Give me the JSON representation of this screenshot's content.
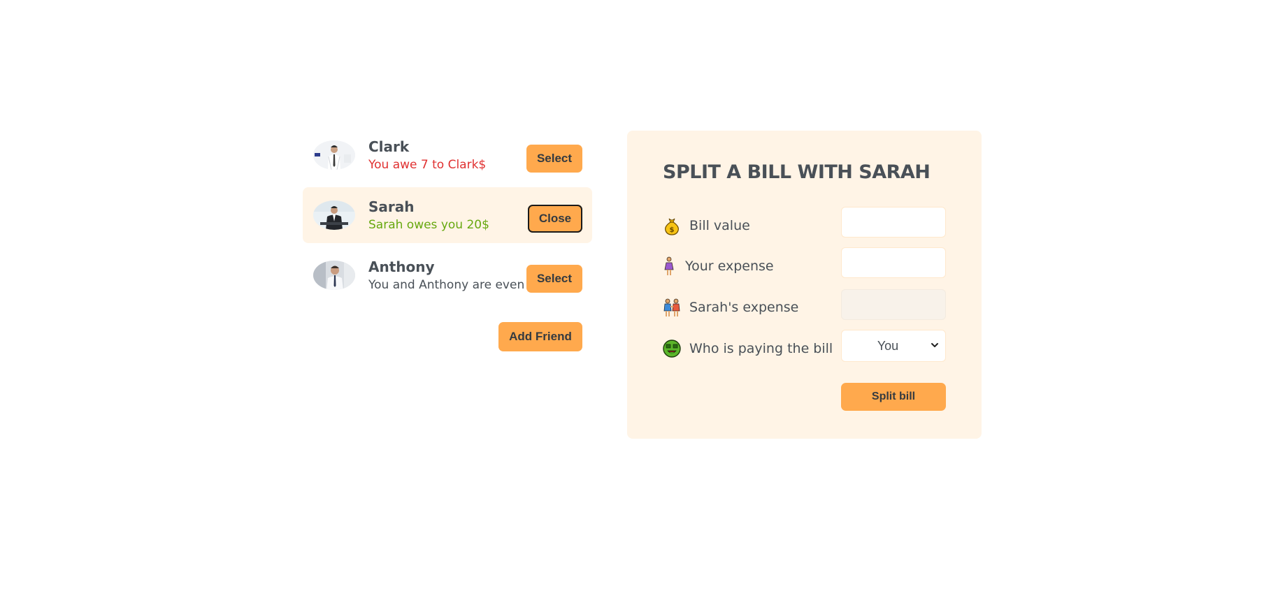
{
  "friends": [
    {
      "name": "Clark",
      "balance": "You awe 7 to Clark$",
      "balance_kind": "owe",
      "button": "Select",
      "selected": false
    },
    {
      "name": "Sarah",
      "balance": "Sarah owes you 20$",
      "balance_kind": "owed",
      "button": "Close",
      "selected": true
    },
    {
      "name": "Anthony",
      "balance": "You and Anthony are even",
      "balance_kind": "even",
      "button": "Select",
      "selected": false
    }
  ],
  "add_friend_label": "Add Friend",
  "split": {
    "title": "SPLIT A BILL WITH SARAH",
    "bill_value_label": "Bill value",
    "bill_value": "",
    "your_expense_label": "Your expense",
    "your_expense": "",
    "friend_expense_label": "Sarah's expense",
    "friend_expense": "",
    "payer_label": "Who is paying the bill",
    "payer_selected": "You",
    "submit_label": "Split bill"
  },
  "colors": {
    "accent": "#ffa94d",
    "panel_bg": "#fff4e6",
    "text": "#495057",
    "owe": "#e03131",
    "owed": "#66a80f"
  },
  "icons": {
    "bill_value": "money-bag-icon",
    "your_expense": "woman-standing-icon",
    "friend_expense": "women-holding-hands-icon",
    "payer": "money-mouth-face-icon",
    "select": "chevron-down-icon"
  }
}
